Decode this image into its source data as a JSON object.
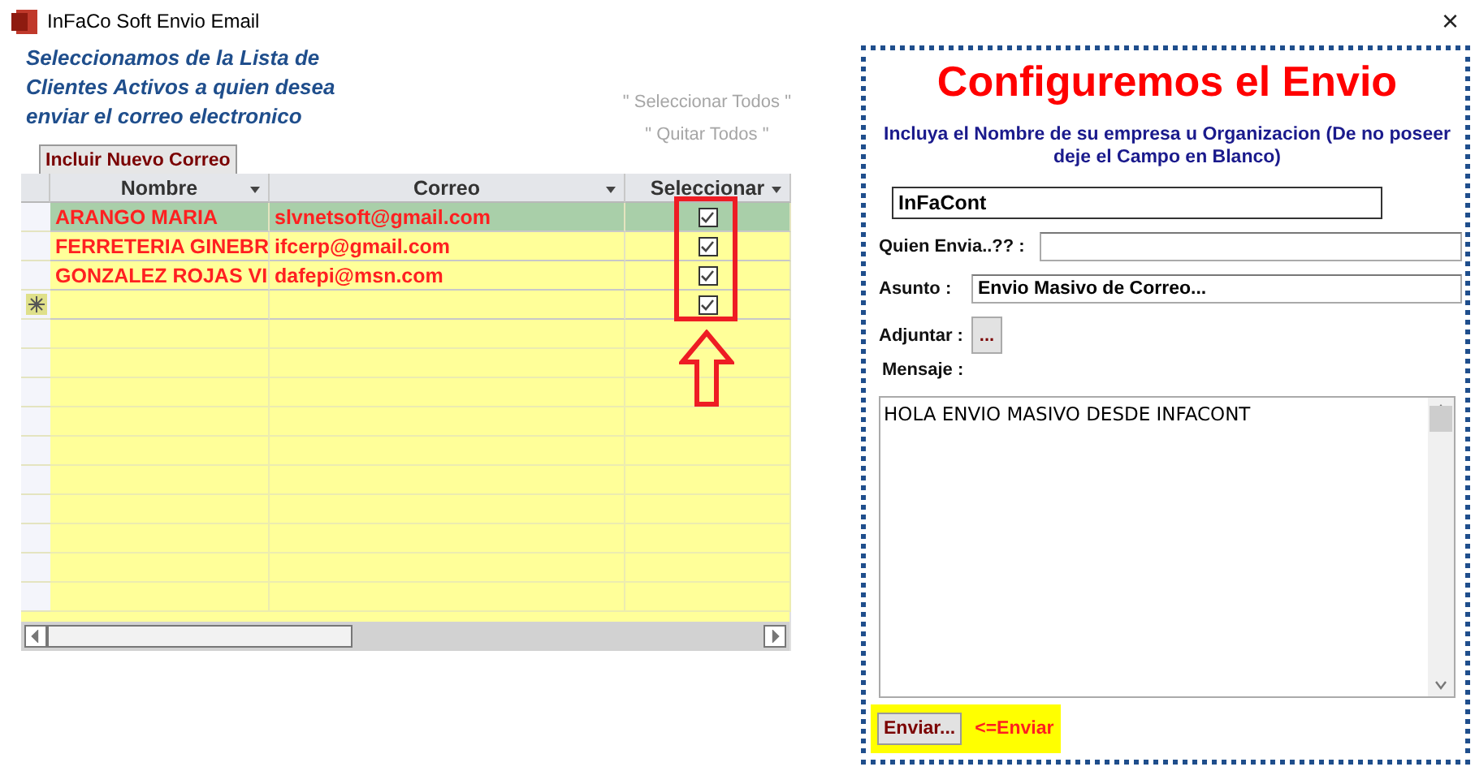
{
  "window": {
    "title": "InFaCo Soft Envio Email",
    "close": "×"
  },
  "left": {
    "description": "Seleccionamos de la Lista de Clientes Activos a quien desea enviar el correo electronico",
    "add_button": "Incluir Nuevo Correo",
    "links": [
      "\" Seleccionar Todos \"",
      "\" Quitar Todos \""
    ]
  },
  "table": {
    "columns": [
      "Nombre",
      "Correo",
      "Seleccionar"
    ],
    "rows": [
      {
        "nombre": "ARANGO  MARIA",
        "correo": "slvnetsoft@gmail.com",
        "checked": true,
        "selected": true
      },
      {
        "nombre": "FERRETERIA GINEBR",
        "correo": "ifcerp@gmail.com",
        "checked": true,
        "selected": false
      },
      {
        "nombre": "GONZALEZ ROJAS VI",
        "correo": "dafepi@msn.com",
        "checked": true,
        "selected": false
      }
    ],
    "new_row": {
      "checked": true
    }
  },
  "form": {
    "title": "Configuremos el Envio",
    "instruction": "Incluya el Nombre de su empresa u Organizacion (De no poseer deje el Campo en Blanco)",
    "company": "InFaCont",
    "sender_label": "Quien Envia..?? :",
    "subject_label": "Asunto :",
    "subject": "Envio Masivo de Correo...",
    "attach_label": "Adjuntar :",
    "attach_button": "...",
    "message_label": "Mensaje :",
    "message": "HOLA ENVIO MASIVO DESDE INFACONT",
    "send_button": "Enviar...",
    "send_hint": "<=Enviar"
  }
}
